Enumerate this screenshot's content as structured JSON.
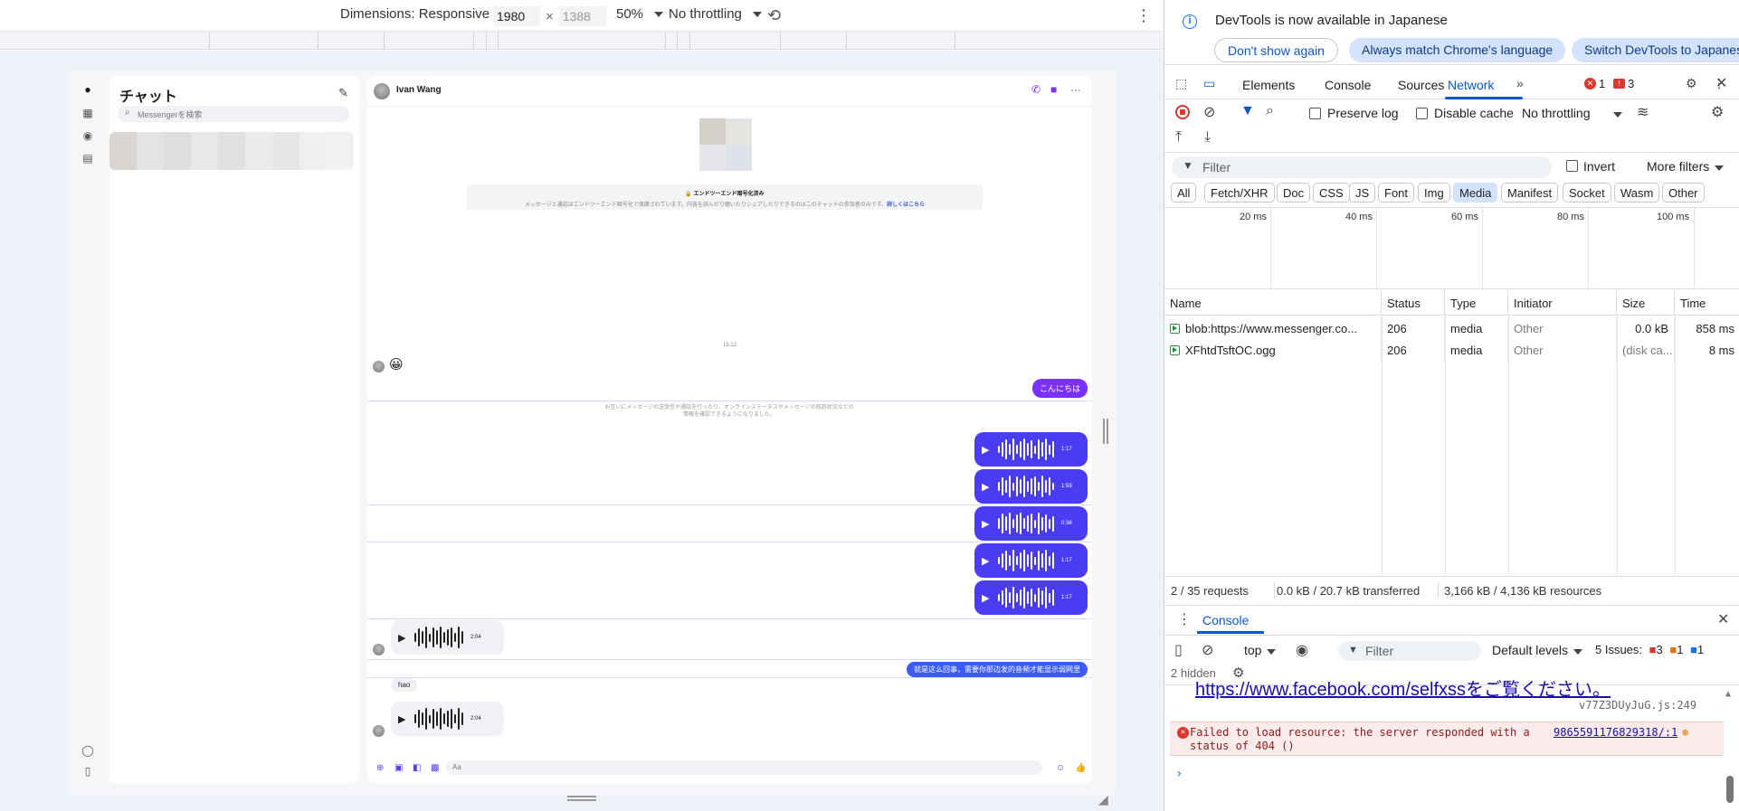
{
  "device_toolbar": {
    "dimensions_label": "Dimensions: Responsive",
    "width": "1980",
    "times": "×",
    "height": "1388",
    "zoom": "50%",
    "throttling": "No throttling"
  },
  "messenger": {
    "sidebar_title": "チャット",
    "search_placeholder": "Messengerを検索",
    "contact_name": "Ivan Wang",
    "e2e_title": "🔒 エンドツーエンド暗号化済み",
    "e2e_desc": "メッセージと通話はエンドツーエンド暗号化で保護されています。内容を読んだり聴いたりシェアしたりできるのはこのチャットの参加者のみです。",
    "e2e_link": "詳しくはこちら",
    "time_label": "15:12",
    "emoji_in": "😀",
    "msg_out_1": "こんにちは",
    "info_note": "お互いにメッセージの送受信や通話を行ったり、オンラインステータスやメッセージの既読状況などの情報を確認できるようになりました。",
    "voice_out": [
      {
        "duration": "1:17"
      },
      {
        "duration": "1:59"
      },
      {
        "duration": "0:38"
      },
      {
        "duration": "1:17"
      },
      {
        "duration": "1:17"
      }
    ],
    "voice_in_1": "2:04",
    "msg_out_2": "就是这么回事，需要你那边发的音频才能显示弱网里",
    "msg_in_hao": "hao",
    "voice_in_2": "2:04",
    "composer_placeholder": "Aa"
  },
  "devtools": {
    "info_message": "DevTools is now available in Japanese",
    "dont_show": "Don't show again",
    "match_lang": "Always match Chrome's language",
    "switch_lang": "Switch DevTools to Japanese",
    "tabs": [
      "Elements",
      "Console",
      "Sources",
      "Network"
    ],
    "error_count": "1",
    "warning_count": "3",
    "preserve_log": "Preserve log",
    "disable_cache": "Disable cache",
    "throttling": "No throttling",
    "filter_placeholder": "Filter",
    "invert": "Invert",
    "more_filters": "More filters",
    "type_filters": [
      "All",
      "Fetch/XHR",
      "Doc",
      "CSS",
      "JS",
      "Font",
      "Img",
      "Media",
      "Manifest",
      "Socket",
      "Wasm",
      "Other"
    ],
    "timeline_labels": [
      "20 ms",
      "40 ms",
      "60 ms",
      "80 ms",
      "100 ms"
    ],
    "columns": [
      "Name",
      "Status",
      "Type",
      "Initiator",
      "Size",
      "Time"
    ],
    "rows": [
      {
        "name": "blob:https://www.messenger.co...",
        "status": "206",
        "type": "media",
        "initiator": "Other",
        "size": "0.0 kB",
        "time": "858 ms"
      },
      {
        "name": "XFhtdTsftOC.ogg",
        "status": "206",
        "type": "media",
        "initiator": "Other",
        "size": "(disk ca...",
        "time": "8 ms"
      }
    ],
    "status_requests": "2 / 35 requests",
    "status_transferred": "0.0 kB / 20.7 kB transferred",
    "status_resources": "3,166 kB / 4,136 kB resources",
    "console_tab": "Console",
    "console_context": "top",
    "console_filter": "Filter",
    "default_levels": "Default levels",
    "issues_label": "5 Issues:",
    "issues_err": "3",
    "issues_warn": "1",
    "issues_info": "1",
    "hidden": "2 hidden",
    "console_link": "https://www.facebook.com/selfxssをご覧ください。",
    "console_link_src": "v77Z3DUyJuG.js:249",
    "console_error": "Failed to load resource: the server responded with a status of 404 ()",
    "console_error_src": "9865591176829318/:1"
  }
}
